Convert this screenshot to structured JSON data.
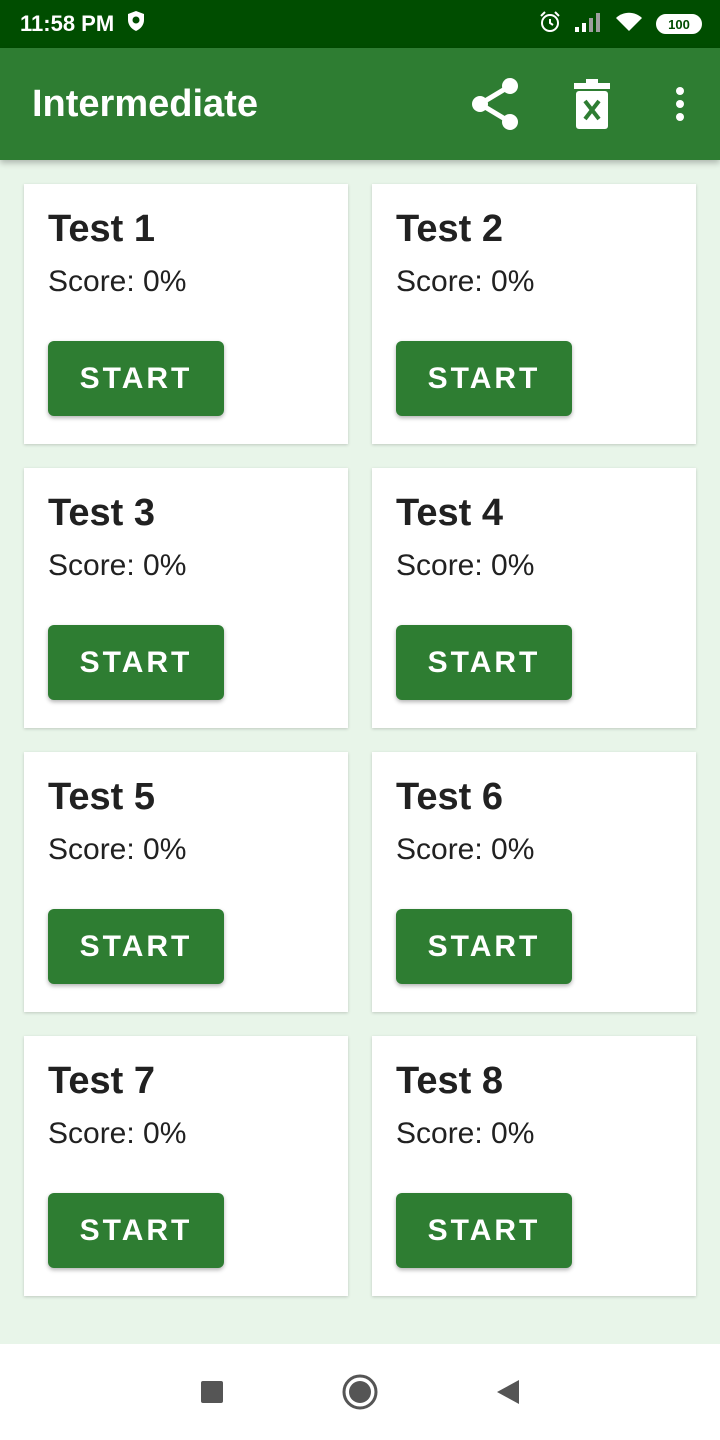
{
  "status_bar": {
    "time": "11:58 PM",
    "battery": "100",
    "icons": [
      "shield-icon",
      "alarm-icon",
      "signal-icon",
      "wifi-icon",
      "battery-icon"
    ]
  },
  "app_bar": {
    "title": "Intermediate",
    "actions": [
      "share-icon",
      "delete-icon",
      "more-vert-icon"
    ]
  },
  "tests": [
    {
      "title": "Test 1",
      "score": "Score: 0%",
      "button": "START"
    },
    {
      "title": "Test 2",
      "score": "Score: 0%",
      "button": "START"
    },
    {
      "title": "Test 3",
      "score": "Score: 0%",
      "button": "START"
    },
    {
      "title": "Test 4",
      "score": "Score: 0%",
      "button": "START"
    },
    {
      "title": "Test 5",
      "score": "Score: 0%",
      "button": "START"
    },
    {
      "title": "Test 6",
      "score": "Score: 0%",
      "button": "START"
    },
    {
      "title": "Test 7",
      "score": "Score: 0%",
      "button": "START"
    },
    {
      "title": "Test 8",
      "score": "Score: 0%",
      "button": "START"
    }
  ],
  "nav_bar": {
    "buttons": [
      "recents-icon",
      "home-icon",
      "back-icon"
    ]
  },
  "colors": {
    "primary": "#2e7d32",
    "primary_dark": "#004d00",
    "background": "#e8f5e9",
    "card": "#ffffff",
    "text": "#212121"
  }
}
